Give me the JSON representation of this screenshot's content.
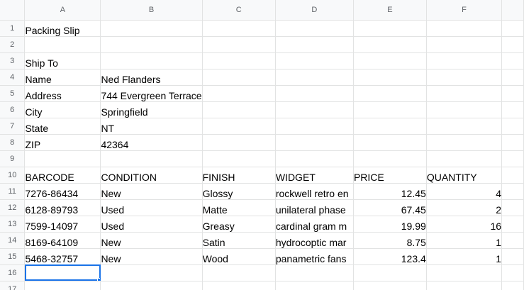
{
  "columns": [
    "A",
    "B",
    "C",
    "D",
    "E",
    "F"
  ],
  "rows": [
    {
      "n": "1",
      "cells": [
        "Packing Slip",
        "",
        "",
        "",
        "",
        ""
      ]
    },
    {
      "n": "2",
      "cells": [
        "",
        "",
        "",
        "",
        "",
        ""
      ]
    },
    {
      "n": "3",
      "cells": [
        "Ship To",
        "",
        "",
        "",
        "",
        ""
      ]
    },
    {
      "n": "4",
      "cells": [
        "Name",
        "Ned Flanders",
        "",
        "",
        "",
        ""
      ]
    },
    {
      "n": "5",
      "cells": [
        "Address",
        "744 Evergreen Terrace",
        "",
        "",
        "",
        ""
      ]
    },
    {
      "n": "6",
      "cells": [
        "City",
        "Springfield",
        "",
        "",
        "",
        ""
      ]
    },
    {
      "n": "7",
      "cells": [
        "State",
        "NT",
        "",
        "",
        "",
        ""
      ]
    },
    {
      "n": "8",
      "cells": [
        "ZIP",
        "42364",
        "",
        "",
        "",
        ""
      ]
    },
    {
      "n": "9",
      "cells": [
        "",
        "",
        "",
        "",
        "",
        ""
      ]
    },
    {
      "n": "10",
      "cells": [
        "BARCODE",
        "CONDITION",
        "FINISH",
        "WIDGET",
        "PRICE",
        "QUANTITY"
      ]
    },
    {
      "n": "11",
      "cells": [
        "7276-86434",
        "New",
        "Glossy",
        "rockwell retro en",
        "12.45",
        "4"
      ]
    },
    {
      "n": "12",
      "cells": [
        "6128-89793",
        "Used",
        "Matte",
        "unilateral phase",
        "67.45",
        "2"
      ]
    },
    {
      "n": "13",
      "cells": [
        "7599-14097",
        "Used",
        "Greasy",
        "cardinal gram m",
        "19.99",
        "16"
      ]
    },
    {
      "n": "14",
      "cells": [
        "8169-64109",
        "New",
        "Satin",
        "hydrocoptic mar",
        "8.75",
        "1"
      ]
    },
    {
      "n": "15",
      "cells": [
        "5468-32757",
        "New",
        "Wood",
        "panametric fans",
        "123.4",
        "1"
      ]
    },
    {
      "n": "16",
      "cells": [
        "",
        "",
        "",
        "",
        "",
        ""
      ]
    },
    {
      "n": "17",
      "cells": [
        "",
        "",
        "",
        "",
        "",
        ""
      ]
    }
  ],
  "numeric_rows": [
    "11",
    "12",
    "13",
    "14",
    "15"
  ],
  "selected_cell": "A16",
  "colors": {
    "selection": "#1a73e8",
    "header_bg": "#f8f9fa",
    "gridline": "#e2e3e3"
  }
}
